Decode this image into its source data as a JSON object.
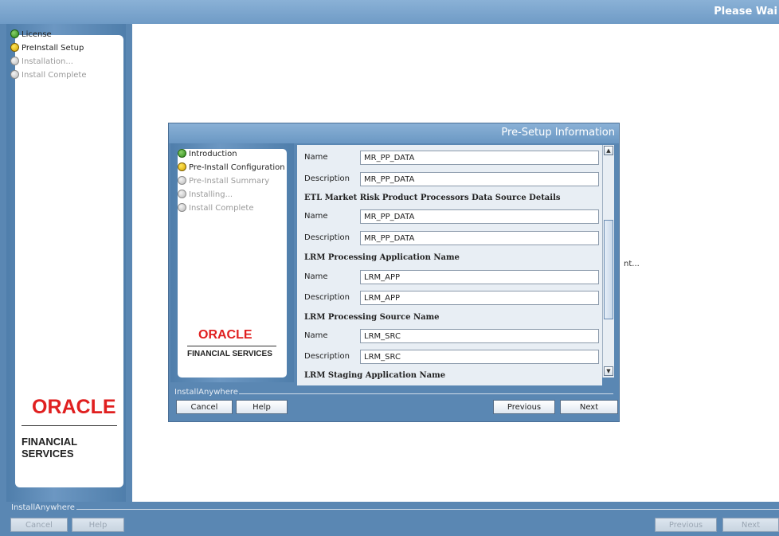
{
  "window": {
    "title": "Please Wai"
  },
  "outer_steps": [
    {
      "label": "License",
      "state": "done"
    },
    {
      "label": "PreInstall Setup",
      "state": "current"
    },
    {
      "label": "Installation...",
      "state": "todo"
    },
    {
      "label": "Install Complete",
      "state": "todo"
    }
  ],
  "branding": {
    "oracle": "ORACLE",
    "financial_services": "FINANCIAL SERVICES",
    "brand_color": "#e02020"
  },
  "background_text": "nt...",
  "outer_footer": {
    "installanywhere": "InstallAnywhere",
    "cancel": "Cancel",
    "help": "Help",
    "previous": "Previous",
    "next": "Next"
  },
  "dialog": {
    "title": "Pre-Setup Information",
    "steps": [
      {
        "label": "Introduction",
        "state": "done"
      },
      {
        "label": "Pre-Install Configuration",
        "state": "current"
      },
      {
        "label": "Pre-Install Summary",
        "state": "todo"
      },
      {
        "label": "Installing...",
        "state": "todo"
      },
      {
        "label": "Install Complete",
        "state": "todo"
      }
    ],
    "form": {
      "name_label": "Name",
      "description_label": "Description",
      "top_name": "MR_PP_DATA",
      "top_description": "MR_PP_DATA",
      "section1": "ETL Market Risk Product Processors Data Source Details",
      "s1_name": "MR_PP_DATA",
      "s1_description": "MR_PP_DATA",
      "section2": "LRM Processing Application Name",
      "s2_name": "LRM_APP",
      "s2_description": "LRM_APP",
      "section3": "LRM Processing Source Name",
      "s3_name": "LRM_SRC",
      "s3_description": "LRM_SRC",
      "section4": "LRM Staging Application Name"
    },
    "footer": {
      "installanywhere": "InstallAnywhere",
      "cancel": "Cancel",
      "help": "Help",
      "previous": "Previous",
      "next": "Next"
    }
  }
}
